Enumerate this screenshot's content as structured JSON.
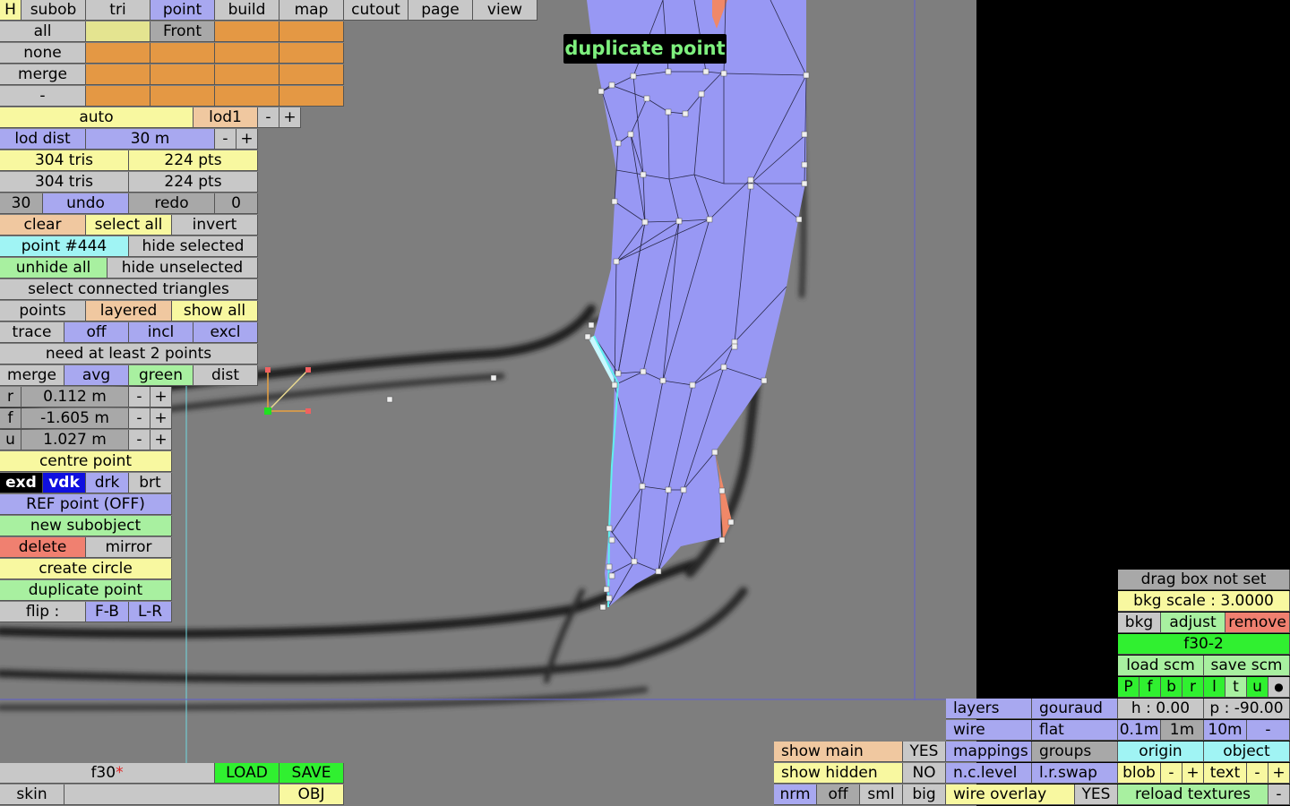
{
  "tooltip": "duplicate point",
  "menubar": [
    "H",
    "subob",
    "tri",
    "point",
    "build",
    "map",
    "cutout",
    "page",
    "view"
  ],
  "sel_rows": [
    "all",
    "none",
    "merge",
    "-"
  ],
  "front_label": "Front",
  "lod": {
    "auto": "auto",
    "lod1": "lod1",
    "minus": "-",
    "plus": "+"
  },
  "lod_dist": {
    "label": "lod dist",
    "value": "30 m"
  },
  "stats": [
    {
      "tris": "304 tris",
      "pts": "224 pts"
    },
    {
      "tris": "304 tris",
      "pts": "224 pts"
    }
  ],
  "undo_row": {
    "count": "30",
    "undo": "undo",
    "redo": "redo",
    "redo_count": "0"
  },
  "sel_row": {
    "clear": "clear",
    "select_all": "select all",
    "invert": "invert"
  },
  "point_row": {
    "point": "point #444",
    "hide_selected": "hide selected"
  },
  "unhide_row": {
    "unhide_all": "unhide all",
    "hide_unselected": "hide unselected"
  },
  "select_connected": "select connected triangles",
  "points_row": {
    "points": "points",
    "layered": "layered",
    "show_all": "show all"
  },
  "trace_row": {
    "trace": "trace",
    "off": "off",
    "incl": "incl",
    "excl": "excl"
  },
  "need_points": "need at least 2 points",
  "merge_row": {
    "merge": "merge",
    "avg": "avg",
    "green": "green",
    "dist": "dist"
  },
  "coords": [
    {
      "axis": "r",
      "value": "0.112 m"
    },
    {
      "axis": "f",
      "value": "-1.605 m"
    },
    {
      "axis": "u",
      "value": "1.027 m"
    }
  ],
  "pm": {
    "minus": "-",
    "plus": "+"
  },
  "centre_point": "centre point",
  "shade_row": {
    "exd": "exd",
    "vdk": "vdk",
    "drk": "drk",
    "brt": "brt"
  },
  "ref_point": "REF point (OFF)",
  "new_subobject": "new subobject",
  "delete_row": {
    "delete": "delete",
    "mirror": "mirror"
  },
  "create_circle": "create circle",
  "duplicate_point": "duplicate point",
  "flip_row": {
    "flip": "flip :",
    "fb": "F-B",
    "lr": "L-R"
  },
  "file": {
    "name": "f30",
    "dirty": "*",
    "load": "LOAD",
    "save": "SAVE",
    "skin": "skin",
    "obj": "OBJ"
  },
  "bottom_mid": {
    "show_main": "show main",
    "show_main_val": "YES",
    "show_hidden": "show hidden",
    "show_hidden_val": "NO",
    "nrm": "nrm",
    "off": "off",
    "sml": "sml",
    "big": "big"
  },
  "render_opts": {
    "layers": "layers",
    "gouraud": "gouraud",
    "wire": "wire",
    "flat": "flat",
    "mappings": "mappings",
    "groups": "groups",
    "nclevel": "n.c.level",
    "lrswap": "l.r.swap",
    "wire_overlay": "wire overlay",
    "wire_overlay_val": "YES"
  },
  "bkg_panel": {
    "drag_box": "drag box not set",
    "bkg_scale": "bkg scale : 3.0000",
    "bkg": "bkg",
    "adjust": "adjust",
    "remove": "remove",
    "name": "f30-2",
    "load_scm": "load scm",
    "save_scm": "save scm",
    "views": [
      "P",
      "f",
      "b",
      "r",
      "l",
      "t",
      "u",
      "●"
    ],
    "h": "h : 0.00",
    "p": "p : -90.00",
    "steps": [
      "0.1m",
      "1m",
      "10m",
      "-"
    ],
    "origin": "origin",
    "object": "object",
    "blob": "blob",
    "text": "text",
    "reload": "reload textures",
    "dash": "-"
  }
}
